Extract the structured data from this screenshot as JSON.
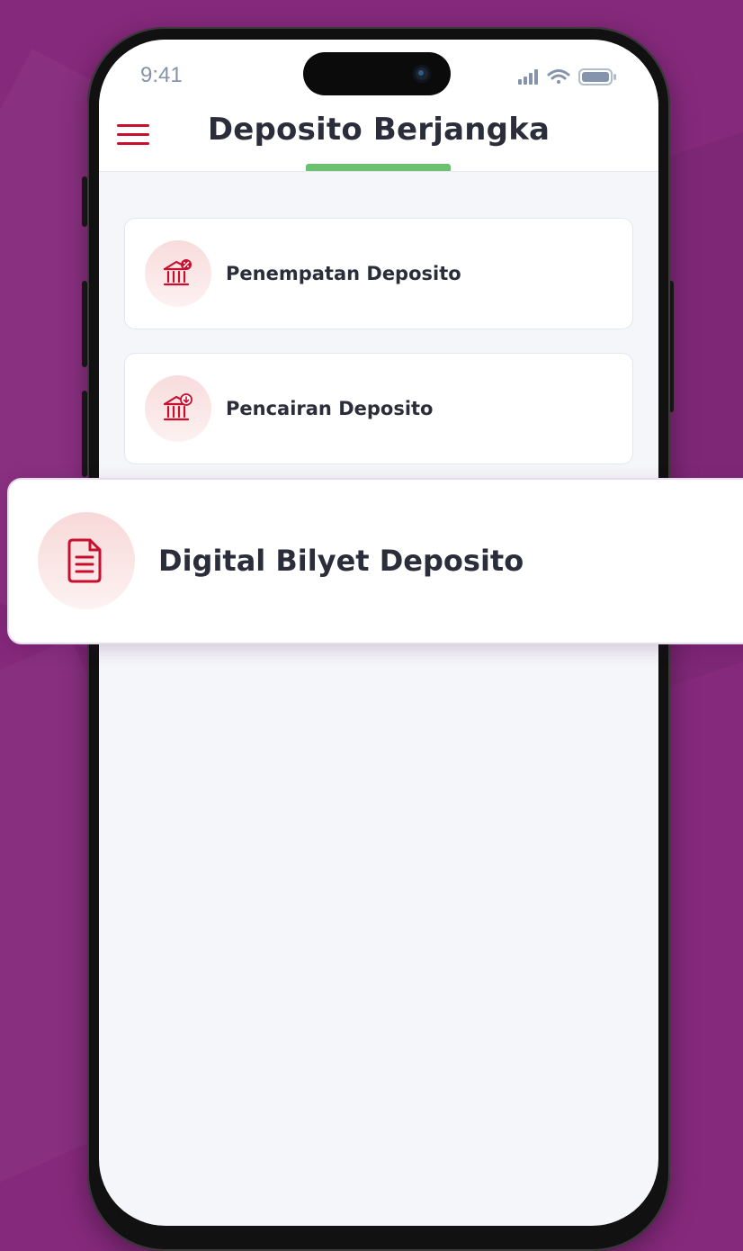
{
  "status_bar": {
    "time": "9:41"
  },
  "header": {
    "title": "Deposito Berjangka",
    "menu_icon": "hamburger-menu-icon",
    "accent_color": "#c8102e",
    "tab_indicator_color": "#6bc06d"
  },
  "menu_items": [
    {
      "label": "Penempatan Deposito",
      "icon": "bank-percent-icon"
    },
    {
      "label": "Pencairan Deposito",
      "icon": "bank-withdraw-icon"
    }
  ],
  "highlight_card": {
    "label": "Digital Bilyet Deposito",
    "icon": "document-icon"
  },
  "colors": {
    "background": "#85297c",
    "icon_red": "#c8102e",
    "text_dark": "#2b2d3b"
  }
}
